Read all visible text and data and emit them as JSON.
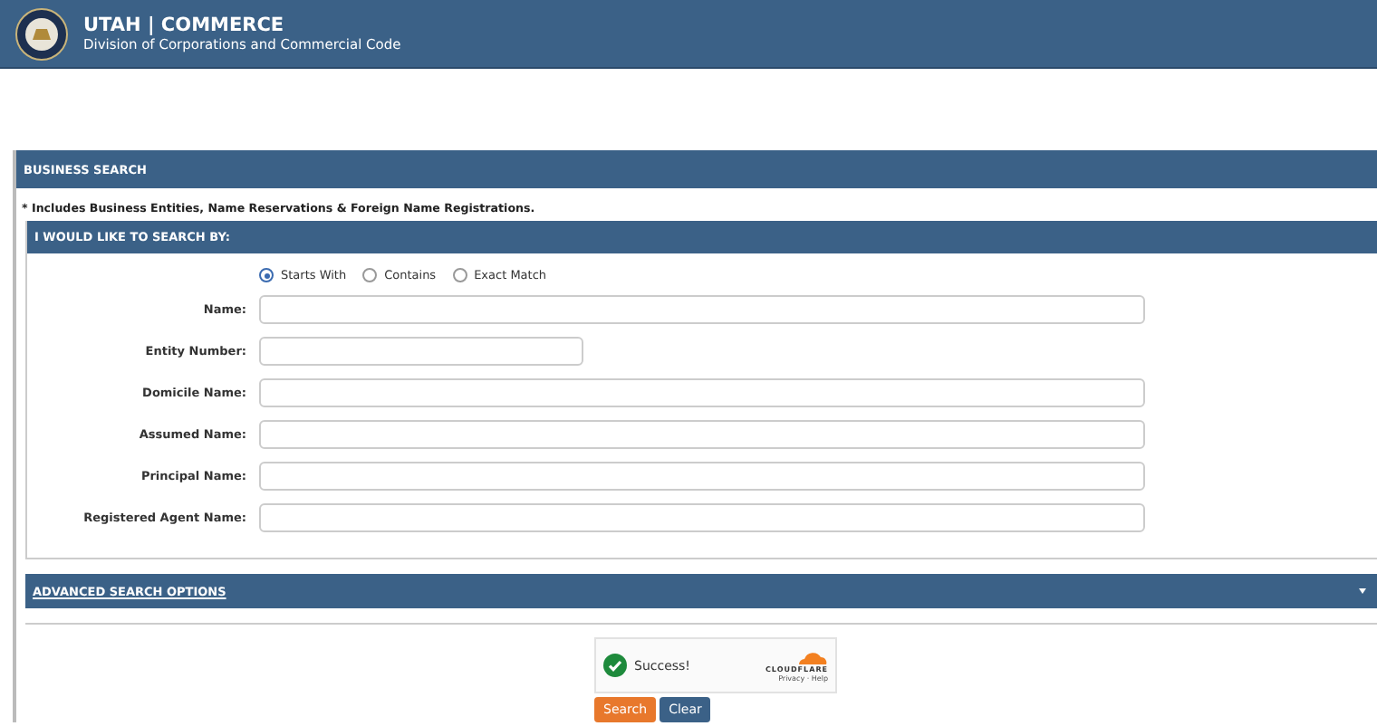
{
  "header": {
    "title": "UTAH | COMMERCE",
    "subtitle": "Division of Corporations and Commercial Code"
  },
  "panel": {
    "title": "BUSINESS SEARCH",
    "note": "* Includes Business Entities, Name Reservations & Foreign Name Registrations."
  },
  "search_by": {
    "title": "I WOULD LIKE TO SEARCH BY:",
    "match_options": [
      {
        "label": "Starts With",
        "selected": true
      },
      {
        "label": "Contains",
        "selected": false
      },
      {
        "label": "Exact Match",
        "selected": false
      }
    ],
    "fields": [
      {
        "label": "Name:",
        "kind": "wide"
      },
      {
        "label": "Entity Number:",
        "kind": "short"
      },
      {
        "label": "Domicile Name:",
        "kind": "wide"
      },
      {
        "label": "Assumed Name:",
        "kind": "wide"
      },
      {
        "label": "Principal Name:",
        "kind": "wide"
      },
      {
        "label": "Registered Agent Name:",
        "kind": "wide"
      }
    ]
  },
  "advanced": {
    "title": "ADVANCED SEARCH OPTIONS",
    "expanded": false
  },
  "captcha": {
    "status": "Success!",
    "brand": "CLOUDFLARE",
    "links": "Privacy · Help"
  },
  "buttons": [
    {
      "label": "Search",
      "kind": "primary"
    },
    {
      "label": "Clear",
      "kind": "secondary"
    }
  ]
}
